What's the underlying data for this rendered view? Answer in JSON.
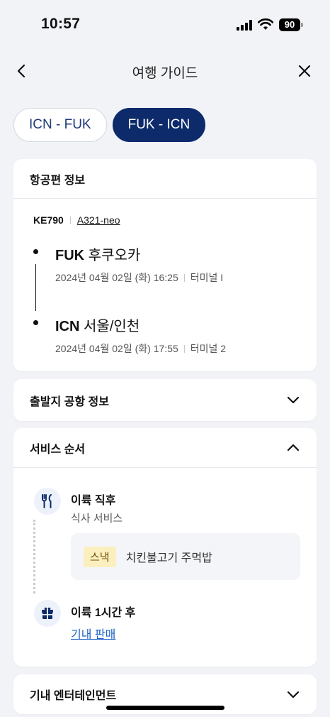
{
  "status_bar": {
    "time": "10:57",
    "battery": "90",
    "icons": [
      "signal-icon",
      "wifi-icon",
      "battery-icon"
    ]
  },
  "nav": {
    "title": "여행 가이드",
    "back_icon": "chevron-left-icon",
    "close_icon": "close-icon"
  },
  "segments": [
    {
      "label": "ICN - FUK",
      "active": false
    },
    {
      "label": "FUK - ICN",
      "active": true
    }
  ],
  "flight_info": {
    "header": "항공편 정보",
    "flight_number": "KE790",
    "aircraft": "A321-neo",
    "departure": {
      "code": "FUK",
      "city": "후쿠오카",
      "datetime": "2024년 04월 02일 (화) 16:25",
      "terminal": "터미널 I"
    },
    "arrival": {
      "code": "ICN",
      "city": "서울/인천",
      "datetime": "2024년 04월 02일 (화) 17:55",
      "terminal": "터미널 2"
    }
  },
  "departure_airport": {
    "header": "출발지 공항 정보",
    "expanded": false
  },
  "service_order": {
    "header": "서비스 순서",
    "expanded": true,
    "steps": [
      {
        "title": "이륙 직후",
        "subtitle": "식사 서비스",
        "icon": "utensils-icon",
        "meal_badge": "스낵",
        "meal_name": "치킨불고기 주먹밥"
      },
      {
        "title": "이륙 1시간 후",
        "link": "기내 판매",
        "icon": "gift-icon"
      }
    ]
  },
  "entertainment": {
    "header": "기내 엔터테인먼트",
    "expanded": false
  },
  "colors": {
    "primary": "#0d2a6b",
    "link": "#1a5fc4",
    "badge_bg": "#fcefbf",
    "background": "#f2f3f7"
  }
}
